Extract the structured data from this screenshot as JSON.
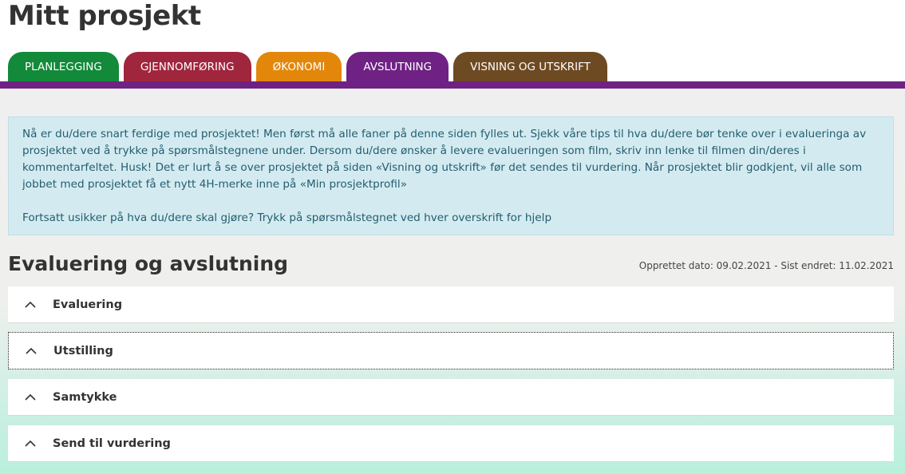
{
  "page": {
    "title": "Mitt prosjekt"
  },
  "tabs": [
    {
      "label": "PLANLEGGING",
      "color": "#128a3a"
    },
    {
      "label": "GJENNOMFØRING",
      "color": "#a0263d"
    },
    {
      "label": "ØKONOMI",
      "color": "#e3870b"
    },
    {
      "label": "AVSLUTNING",
      "color": "#6f2283",
      "active": true
    },
    {
      "label": "VISNING OG UTSKRIFT",
      "color": "#6e4a22"
    }
  ],
  "active_tab_color": "#6f2283",
  "info": {
    "paragraph1": "Nå er du/dere snart ferdige med prosjektet! Men først må alle faner på denne siden fylles ut. Sjekk våre tips til hva du/dere bør tenke over i evalueringa av prosjektet ved å trykke på spørsmålstegnene under. Dersom du/dere ønsker å levere evalueringen som film, skriv inn lenke til filmen din/deres i kommentarfeltet. Husk! Det er lurt å se over prosjektet på siden «Visning og utskrift» før det sendes til vurdering. Når prosjektet blir godkjent, vil alle som jobbet med prosjektet få et nytt 4H-merke inne på «Min prosjektprofil»",
    "paragraph2": "Fortsatt usikker på hva du/dere skal gjøre? Trykk på spørsmålstegnet ved hver overskrift for hjelp"
  },
  "section": {
    "title": "Evaluering og avslutning",
    "meta": "Opprettet dato: 09.02.2021 - Sist endret: 11.02.2021"
  },
  "panels": [
    {
      "label": "Evaluering",
      "icon": "chevron-up-icon"
    },
    {
      "label": "Utstilling",
      "icon": "chevron-up-icon",
      "focused": true
    },
    {
      "label": "Samtykke",
      "icon": "chevron-up-icon"
    },
    {
      "label": "Send til vurdering",
      "icon": "chevron-up-icon"
    }
  ]
}
